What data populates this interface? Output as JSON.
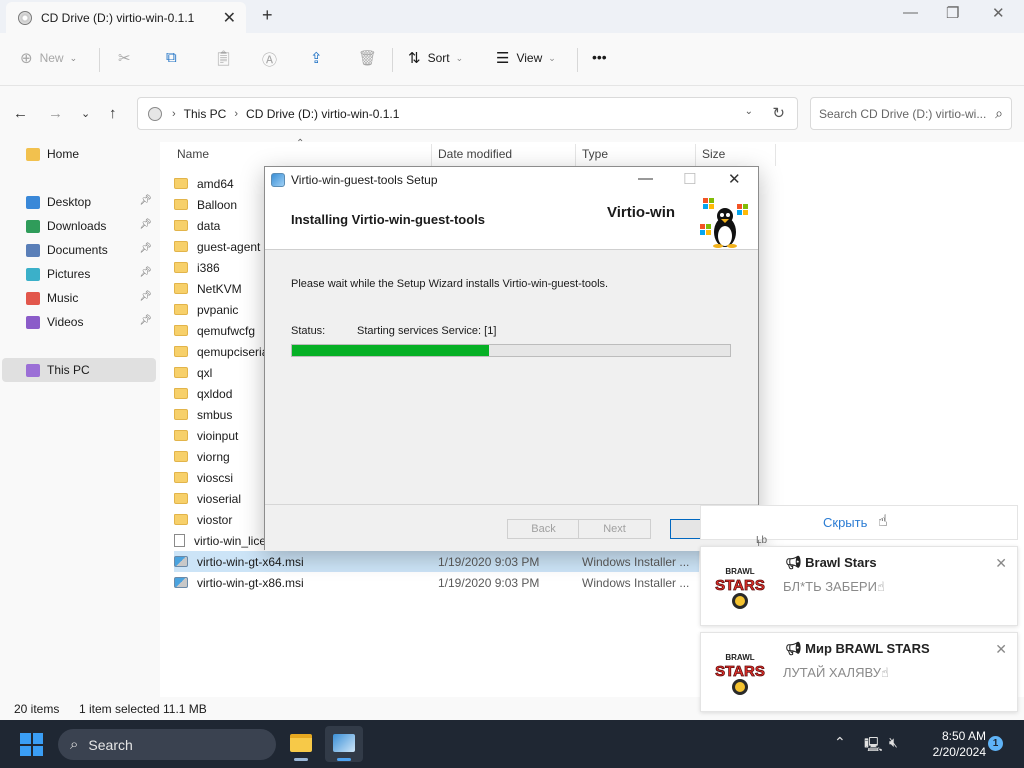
{
  "tab": {
    "title": "CD Drive (D:) virtio-win-0.1.1"
  },
  "commands": {
    "new": "New",
    "sort": "Sort",
    "view": "View",
    "more": "•••"
  },
  "address": {
    "segments": [
      "This PC",
      "CD Drive (D:) virtio-win-0.1.1"
    ],
    "search_placeholder": "Search CD Drive (D:) virtio-wi..."
  },
  "sidebar": {
    "home": "Home",
    "items": [
      {
        "label": "Desktop",
        "color": "#3a88d8"
      },
      {
        "label": "Downloads",
        "color": "#2f9c5a"
      },
      {
        "label": "Documents",
        "color": "#5a7fb8"
      },
      {
        "label": "Pictures",
        "color": "#3bb0c9"
      },
      {
        "label": "Music",
        "color": "#e2574c"
      },
      {
        "label": "Videos",
        "color": "#8b5cc9"
      }
    ],
    "this_pc": "This PC"
  },
  "columns": {
    "name": "Name",
    "date": "Date modified",
    "type": "Type",
    "size": "Size"
  },
  "files": [
    {
      "name": "amd64",
      "kind": "folder"
    },
    {
      "name": "Balloon",
      "kind": "folder"
    },
    {
      "name": "data",
      "kind": "folder"
    },
    {
      "name": "guest-agent",
      "kind": "folder"
    },
    {
      "name": "i386",
      "kind": "folder"
    },
    {
      "name": "NetKVM",
      "kind": "folder"
    },
    {
      "name": "pvpanic",
      "kind": "folder"
    },
    {
      "name": "qemufwcfg",
      "kind": "folder"
    },
    {
      "name": "qemupciserial",
      "kind": "folder"
    },
    {
      "name": "qxl",
      "kind": "folder"
    },
    {
      "name": "qxldod",
      "kind": "folder"
    },
    {
      "name": "smbus",
      "kind": "folder"
    },
    {
      "name": "vioinput",
      "kind": "folder"
    },
    {
      "name": "viorng",
      "kind": "folder"
    },
    {
      "name": "vioscsi",
      "kind": "folder"
    },
    {
      "name": "vioserial",
      "kind": "folder"
    },
    {
      "name": "viostor",
      "kind": "folder"
    },
    {
      "name": "virtio-win_license",
      "kind": "doc"
    },
    {
      "name": "virtio-win-gt-x64.msi",
      "kind": "msi",
      "date": "1/19/2020 9:03 PM",
      "type": "Windows Installer ...",
      "selected": true
    },
    {
      "name": "virtio-win-gt-x86.msi",
      "kind": "msi",
      "date": "1/19/2020 9:03 PM",
      "type": "Windows Installer ..."
    }
  ],
  "status": {
    "items": "20 items",
    "selected": "1 item selected",
    "size": "11.1 MB"
  },
  "dialog": {
    "title": "Virtio-win-guest-tools Setup",
    "heading": "Installing Virtio-win-guest-tools",
    "brand": "Virtio-win",
    "body": "Please wait while the Setup Wizard installs Virtio-win-guest-tools.",
    "status_label": "Status:",
    "status_value": "Starting services Service: [1]",
    "progress_percent": 45,
    "back": "Back",
    "next": "Next",
    "cancel": "C"
  },
  "notifications": {
    "hide": "Скрыть",
    "stray": "Lb",
    "items": [
      {
        "title": "Brawl Stars",
        "message": "БЛ*ТЬ ЗАБЕРИ☝",
        "logo_top": "BRAWL",
        "logo_main": "STARS"
      },
      {
        "title": "Мир BRAWL STARS",
        "message": "ЛУТАЙ ХАЛЯВУ☝",
        "logo_top": "BRAWL",
        "logo_main": "STARS"
      }
    ]
  },
  "taskbar": {
    "search": "Search",
    "time": "8:50 AM",
    "date": "2/20/2024",
    "badge": "1"
  }
}
